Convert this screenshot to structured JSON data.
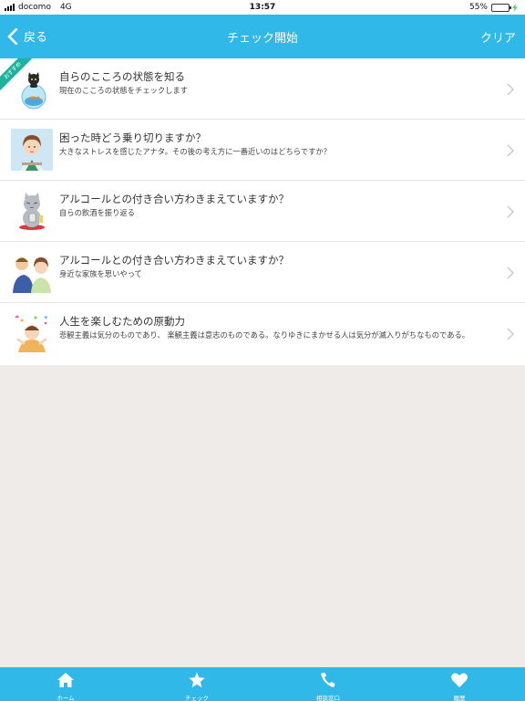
{
  "status_bar": {
    "carrier": "docomo",
    "network": "4G",
    "time": "13:57",
    "battery_percent": "55%",
    "battery_level": 0.55
  },
  "nav": {
    "back_label": "戻る",
    "title": "チェック開始",
    "clear_label": "クリア"
  },
  "items": [
    {
      "title": "自らのこころの状態を知る",
      "subtitle": "現在のこころの状態をチェックします",
      "badge": "おすすめ",
      "thumb_icon": "cat-fishbowl-icon"
    },
    {
      "title": "困った時どう乗り切りますか？",
      "subtitle": "大きなストレスを感じたアナタ。その後の考え方に一番近いのはどちらですか？",
      "thumb_icon": "woman-thinking-icon"
    },
    {
      "title": "アルコールとの付き合い方わきまえていますか？",
      "subtitle": "自らの飲酒を振り返る",
      "thumb_icon": "cat-drinking-icon"
    },
    {
      "title": "アルコールとの付き合い方わきまえていますか？",
      "subtitle": "身近な家族を思いやって",
      "thumb_icon": "family-icon"
    },
    {
      "title": "人生を楽しむための原動力",
      "subtitle": "悲観主義は気分のものであり、 楽観主義は意志のものである。なりゆきにまかせる人は気分が滅入りがちなものである。",
      "thumb_icon": "person-celebrating-icon"
    }
  ],
  "tabs": [
    {
      "label": "ホーム",
      "icon": "home-icon"
    },
    {
      "label": "チェック",
      "icon": "star-icon"
    },
    {
      "label": "相談窓口",
      "icon": "phone-icon"
    },
    {
      "label": "履歴",
      "icon": "heart-icon"
    }
  ],
  "colors": {
    "brand": "#30b8e8",
    "badge": "#1bb39b",
    "background": "#efebe8"
  }
}
